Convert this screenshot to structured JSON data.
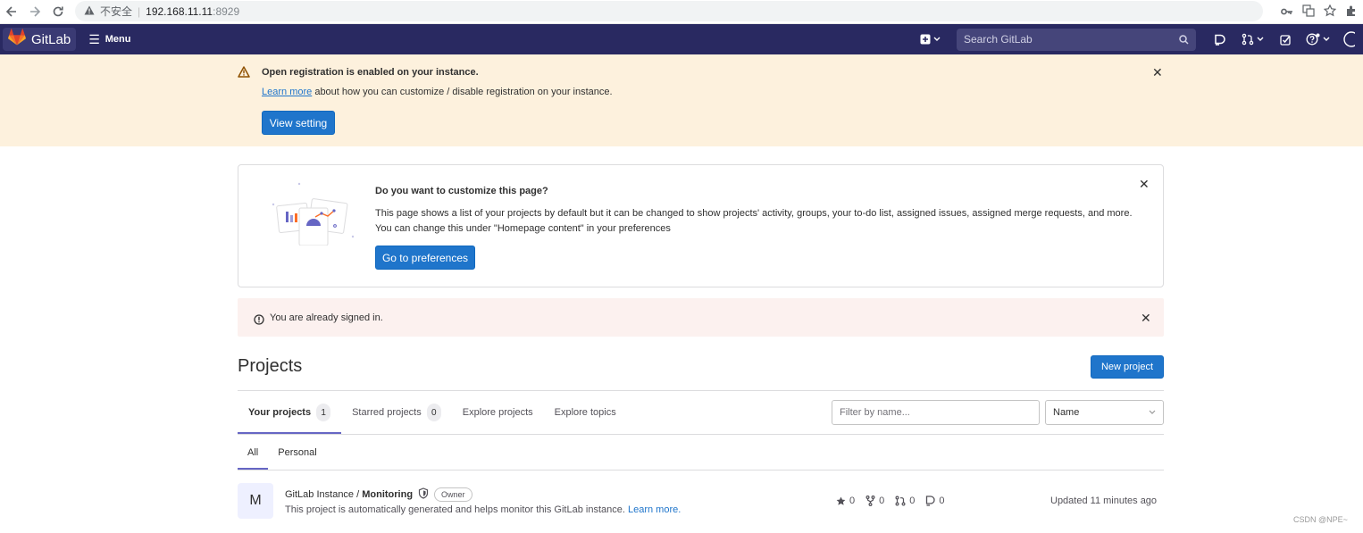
{
  "browser": {
    "insecure_label": "不安全",
    "host": "192.168.11.11",
    "port": ":8929"
  },
  "topbar": {
    "logo_text": "GitLab",
    "menu_label": "Menu",
    "search_placeholder": "Search GitLab"
  },
  "registration": {
    "title": "Open registration is enabled on your instance.",
    "link_text": "Learn more",
    "body_rest": " about how you can customize / disable registration on your instance.",
    "button": "View setting"
  },
  "customize": {
    "title": "Do you want to customize this page?",
    "text": "This page shows a list of your projects by default but it can be changed to show projects' activity, groups, your to-do list, assigned issues, assigned merge requests, and more. You can change this under \"Homepage content\" in your preferences",
    "button": "Go to preferences"
  },
  "signed_in": {
    "text": "You are already signed in."
  },
  "projects": {
    "title": "Projects",
    "new_button": "New project",
    "tabs": [
      {
        "label": "Your projects",
        "count": "1"
      },
      {
        "label": "Starred projects",
        "count": "0"
      },
      {
        "label": "Explore projects"
      },
      {
        "label": "Explore topics"
      }
    ],
    "filter_placeholder": "Filter by name...",
    "sort_value": "Name",
    "subtabs": [
      "All",
      "Personal"
    ],
    "items": [
      {
        "avatar": "M",
        "namespace": "GitLab Instance / ",
        "name": "Monitoring",
        "role": "Owner",
        "description": "This project is automatically generated and helps monitor this GitLab instance. ",
        "desc_link": "Learn more.",
        "stars": "0",
        "forks": "0",
        "merge_requests": "0",
        "issues": "0",
        "updated": "Updated 11 minutes ago"
      }
    ]
  },
  "watermark": "CSDN @NPE~",
  "colors": {
    "topbar": "#292961",
    "primary": "#1f75cb",
    "warning_bg": "#fdf1dd",
    "danger_bg": "#fcf1ef",
    "tab_underline": "#6666c4"
  }
}
